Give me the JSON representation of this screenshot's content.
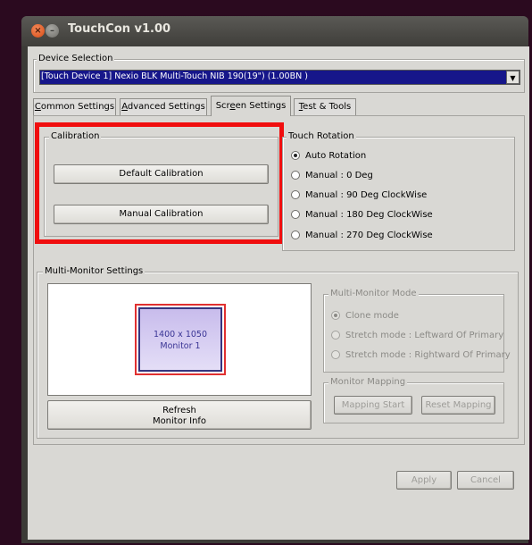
{
  "window": {
    "title": "TouchCon v1.00"
  },
  "device_selection": {
    "legend": "Device Selection",
    "value": "[Touch Device 1] Nexio BLK Multi-Touch NIB 190(19\") (1.00BN )"
  },
  "tabs": [
    {
      "label_pre": "",
      "label_ul": "C",
      "label_post": "ommon Settings"
    },
    {
      "label_pre": "",
      "label_ul": "A",
      "label_post": "dvanced Settings"
    },
    {
      "label_pre": "Scr",
      "label_ul": "e",
      "label_post": "en Settings"
    },
    {
      "label_pre": "",
      "label_ul": "T",
      "label_post": "est & Tools"
    }
  ],
  "calibration": {
    "legend": "Calibration",
    "default_button": "Default Calibration",
    "manual_button": "Manual Calibration"
  },
  "touch_rotation": {
    "legend": "Touch Rotation",
    "options": [
      "Auto Rotation",
      "Manual : 0 Deg",
      "Manual : 90 Deg ClockWise",
      "Manual : 180 Deg ClockWise",
      "Manual : 270 Deg ClockWise"
    ],
    "selected": "Auto Rotation"
  },
  "multi_monitor": {
    "legend": "Multi-Monitor Settings",
    "monitor_resolution": "1400 x 1050",
    "monitor_name": "Monitor 1",
    "refresh_line1": "Refresh",
    "refresh_line2": "Monitor Info",
    "mode_legend": "Multi-Monitor Mode",
    "modes": [
      "Clone mode",
      "Stretch mode : Leftward Of Primary",
      "Stretch mode : Rightward Of Primary"
    ],
    "selected_mode": "Clone mode",
    "mapping_legend": "Monitor Mapping",
    "mapping_start": "Mapping Start",
    "reset_mapping": "Reset Mapping"
  },
  "footer": {
    "apply": "Apply",
    "cancel": "Cancel"
  },
  "colors": {
    "highlight": "#f00e0e",
    "selection_bg": "#16168a",
    "window_bg": "#d9d8d4"
  }
}
